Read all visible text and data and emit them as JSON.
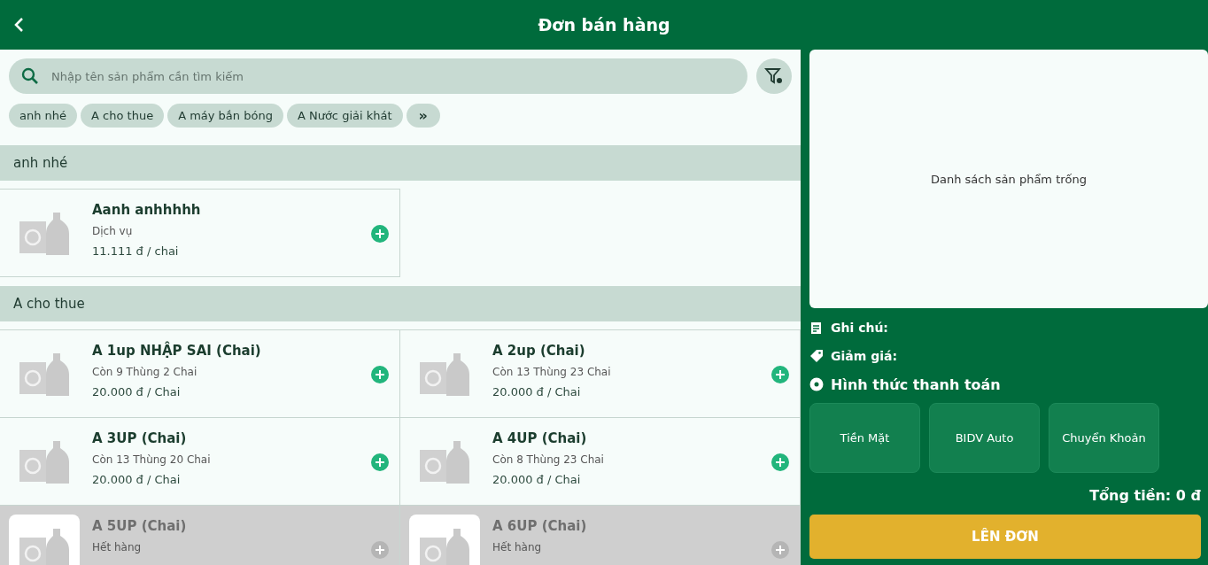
{
  "header": {
    "title": "Đơn bán hàng"
  },
  "search": {
    "placeholder": "Nhập tên sản phẩm cần tìm kiếm"
  },
  "category_chips": [
    {
      "label": "anh nhé"
    },
    {
      "label": "A cho thue"
    },
    {
      "label": "A máy bắn bóng"
    },
    {
      "label": "A Nước giải khát"
    }
  ],
  "more_chip": {
    "label": "»"
  },
  "groups": [
    {
      "title": "anh nhé",
      "products": [
        {
          "name": "Aanh anhhhhh",
          "detail": "Dịch vụ",
          "price": "11.111 đ / chai",
          "in_stock": true
        }
      ]
    },
    {
      "title": "A cho thue",
      "products": [
        {
          "name": "A 1up NHẬP SAI (Chai)",
          "detail": "Còn 9 Thùng 2 Chai",
          "price": "20.000 đ / Chai",
          "in_stock": true
        },
        {
          "name": "A 2up (Chai)",
          "detail": "Còn 13 Thùng 23 Chai",
          "price": "20.000 đ / Chai",
          "in_stock": true
        },
        {
          "name": "A 3UP (Chai)",
          "detail": "Còn 13 Thùng 20 Chai",
          "price": "20.000 đ / Chai",
          "in_stock": true
        },
        {
          "name": "A 4UP (Chai)",
          "detail": "Còn 8 Thùng 23 Chai",
          "price": "20.000 đ / Chai",
          "in_stock": true
        },
        {
          "name": "A 5UP (Chai)",
          "detail": "Hết hàng",
          "in_stock": false
        },
        {
          "name": "A 6UP (Chai)",
          "detail": "Hết hàng",
          "in_stock": false
        }
      ]
    }
  ],
  "cart": {
    "empty_message": "Danh sách sản phẩm trống"
  },
  "note_label": "Ghi chú:",
  "discount_label": "Giảm giá:",
  "payment_label": "Hình thức thanh toán",
  "payment_methods": [
    {
      "label": "Tiền Mặt"
    },
    {
      "label": "BIDV Auto"
    },
    {
      "label": "Chuyển Khoản"
    }
  ],
  "total": "Tổng tiền: 0 đ",
  "submit_button": "LÊN ĐƠN"
}
